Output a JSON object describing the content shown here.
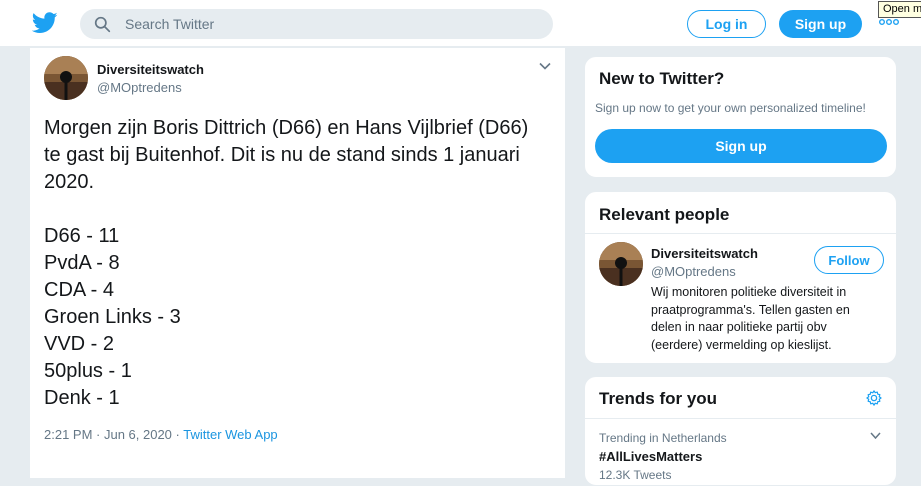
{
  "header": {
    "search_placeholder": "Search Twitter",
    "login_label": "Log in",
    "signup_label": "Sign up",
    "more_tooltip": "Open more"
  },
  "tweet": {
    "author_name": "Diversiteitswatch",
    "author_handle": "@MOptredens",
    "text_lines": [
      "Morgen zijn Boris Dittrich (D66) en Hans Vijlbrief (D66)",
      "te gast bij Buitenhof. Dit is nu de stand sinds 1 januari",
      "2020.",
      "",
      "D66 - 11",
      "PvdA - 8",
      "CDA - 4",
      "Groen Links - 3",
      "VVD - 2",
      "50plus - 1",
      "Denk - 1"
    ],
    "timestamp": "2:21 PM · Jun 6, 2020",
    "separator": " · ",
    "source": "Twitter Web App"
  },
  "new_to_twitter": {
    "title": "New to Twitter?",
    "subtitle": "Sign up now to get your own personalized timeline!",
    "signup_label": "Sign up"
  },
  "relevant_people": {
    "title": "Relevant people",
    "person": {
      "name": "Diversiteitswatch",
      "handle": "@MOptredens",
      "follow_label": "Follow",
      "bio_lines": [
        "Wij monitoren politieke diversiteit in",
        "praatprogramma's. Tellen gasten en",
        "delen in naar politieke partij obv",
        "(eerdere) vermelding op kieslijst."
      ]
    }
  },
  "trends": {
    "title": "Trends for you",
    "items": [
      {
        "context": "Trending in Netherlands",
        "name": "#AllLivesMatters",
        "count": "12.3K Tweets"
      }
    ]
  },
  "colors": {
    "brand": "#1da1f2",
    "background": "#e6ecf0",
    "secondary_text": "#657786"
  }
}
